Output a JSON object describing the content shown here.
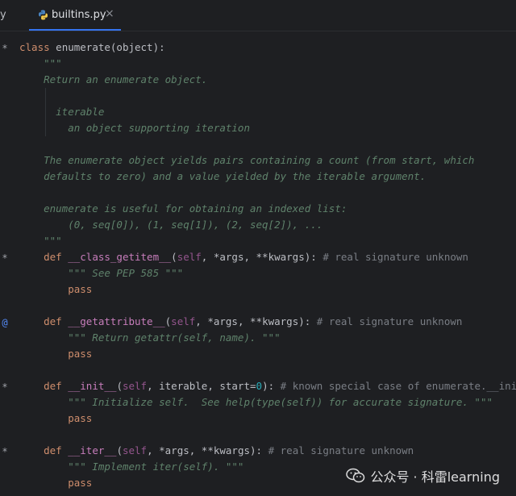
{
  "tabs": {
    "prev_tab_label": "y",
    "active_tab_label": "builtins.py",
    "close_glyph": "×"
  },
  "code": {
    "line1": [
      "class",
      " enumerate(object):"
    ],
    "line2": "    \"\"\"",
    "line3": "    Return an enumerate object.",
    "line4": "",
    "line5": "      iterable",
    "line6": "        an object supporting iteration",
    "line7": "",
    "line8": "    The enumerate object yields pairs containing a count (from start, which",
    "line9": "    defaults to zero) and a value yielded by the iterable argument.",
    "line10": "",
    "line11": "    enumerate is useful for obtaining an indexed list:",
    "line12": "        (0, seq[0]), (1, seq[1]), (2, seq[2]), ...",
    "line13": "    \"\"\"",
    "line14": [
      "    ",
      "def",
      " ",
      "__class_getitem__",
      "(",
      "self",
      ", *args, **kwargs): ",
      "# real signature unknown"
    ],
    "line15": "        \"\"\" See PEP 585 \"\"\"",
    "line16": [
      "        ",
      "pass"
    ],
    "line17": "",
    "line18": [
      "    ",
      "def",
      " ",
      "__getattribute__",
      "(",
      "self",
      ", *args, **kwargs): ",
      "# real signature unknown"
    ],
    "line19": "        \"\"\" Return getattr(self, name). \"\"\"",
    "line20": [
      "        ",
      "pass"
    ],
    "line21": "",
    "line22": [
      "    ",
      "def",
      " ",
      "__init__",
      "(",
      "self",
      ", iterable, start=",
      "0",
      "): ",
      "# known special case of enumerate.__init__"
    ],
    "line23": "        \"\"\" Initialize self.  See help(type(self)) for accurate signature. \"\"\"",
    "line24": [
      "        ",
      "pass"
    ],
    "line25": "",
    "line26": [
      "    ",
      "def",
      " ",
      "__iter__",
      "(",
      "self",
      ", *args, **kwargs): ",
      "# real signature unknown"
    ],
    "line27": "        \"\"\" Implement iter(self). \"\"\"",
    "line28": [
      "        ",
      "pass"
    ]
  },
  "gutter_marks": [
    "*",
    "*",
    "@",
    "*",
    "*"
  ],
  "watermark": {
    "text": "公众号 · 科雷learning"
  },
  "colors": {
    "background": "#1e1f22",
    "keyword": "#cf8e6d",
    "docstring": "#5f826b",
    "dunder": "#c77dbb",
    "self": "#94558d",
    "comment": "#7a7e85",
    "number": "#2aacb8",
    "tab_underline": "#3574f0"
  }
}
